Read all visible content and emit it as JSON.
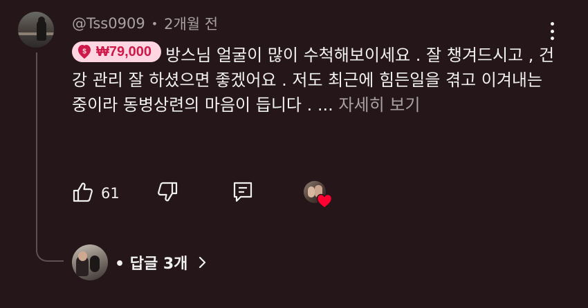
{
  "comment": {
    "username": "@Tss0909",
    "separator": "•",
    "time": "2개월 전",
    "super_thanks": {
      "amount": "₩79,000",
      "icon": "dollar-heart-icon",
      "bg_color": "#fdd6e2",
      "text_color": "#cd1849"
    },
    "text": "방스님 얼굴이 많이 수척해보이세요 . 잘 챙겨드시고 , 건강 관리 잘 하셨으면 좋겠어요 . 저도 최근에 힘든일을 겪고 이겨내는 중이라 동병상련의 마음이 듭니다 . ...",
    "read_more": "자세히 보기"
  },
  "actions": {
    "like_icon": "thumbs-up-icon",
    "like_count": "61",
    "dislike_icon": "thumbs-down-icon",
    "reply_icon": "reply-comment-icon",
    "creator_heart_icon": "heart-icon",
    "heart_color": "#ff0033"
  },
  "replies": {
    "label": "• 답글 3개",
    "chevron_icon": "chevron-right-icon"
  },
  "menu": {
    "more_icon": "more-vertical-icon"
  }
}
